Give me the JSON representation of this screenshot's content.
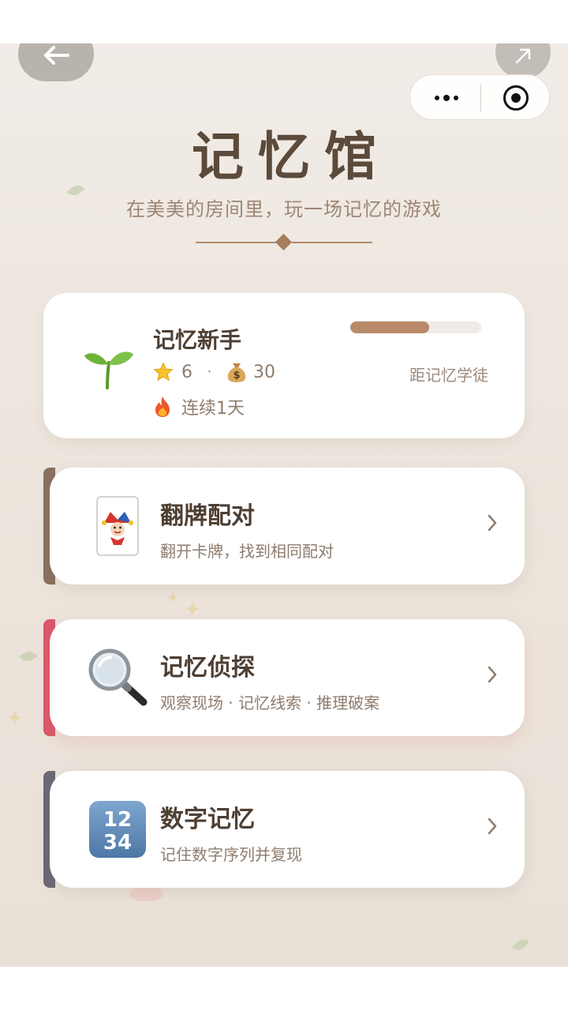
{
  "header": {
    "title": "记忆馆",
    "subtitle": "在美美的房间里，玩一场记忆的游戏"
  },
  "profile": {
    "level_name": "记忆新手",
    "stars": "6",
    "stat_separator": "·",
    "coins": "30",
    "streak": "连续1天",
    "progress_fraction": 0.6,
    "next_level": "距记忆学徒"
  },
  "games": [
    {
      "name": "翻牌配对",
      "desc": "翻开卡牌，找到相同配对",
      "accent": "#8a7060",
      "icon": "joker-card-icon"
    },
    {
      "name": "记忆侦探",
      "desc": "观察现场 · 记忆线索 · 推理破案",
      "accent": "#d9576a",
      "icon": "magnifier-icon"
    },
    {
      "name": "数字记忆",
      "desc": "记住数字序列并复现",
      "accent": "#6b6876",
      "icon": "numbers-1234-icon"
    }
  ],
  "number_icon": {
    "row1": "12",
    "row2": "34"
  },
  "colors": {
    "title": "#5c4a3a",
    "accent_brown": "#b88a6a",
    "background": "#efe9e3"
  }
}
